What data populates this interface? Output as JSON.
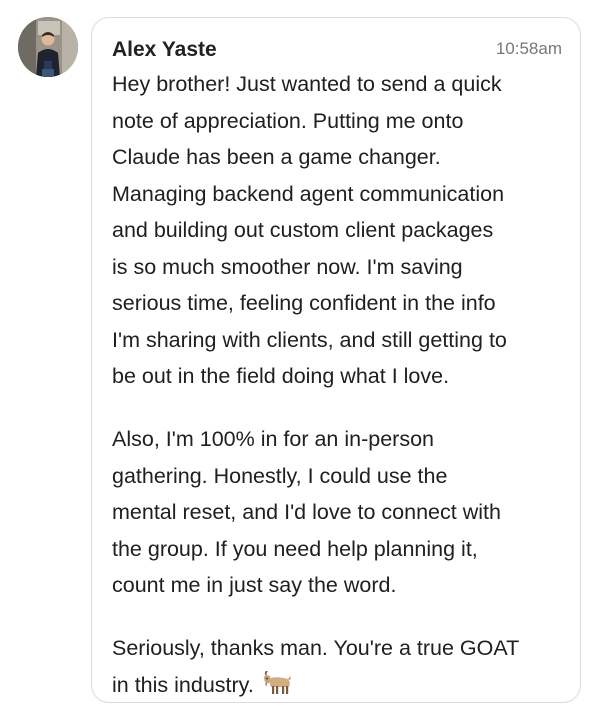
{
  "message": {
    "sender": "Alex Yaste",
    "time": "10:58am",
    "paragraph1": [
      "Hey brother! Just wanted to send a quick",
      "note of appreciation. Putting me onto",
      "Claude has been a game changer.",
      "Managing backend agent communication",
      "and building out custom client packages",
      "is so much smoother now. I'm saving",
      "serious time, feeling confident in the info",
      "I'm sharing with clients, and still getting to",
      "be out in the field doing what I love."
    ],
    "paragraph2": [
      "Also, I'm 100% in for an in-person",
      "gathering. Honestly, I could use the",
      "mental reset, and I'd love to connect with",
      "the group. If you need help planning it,",
      "count me in just say the word."
    ],
    "paragraph3": [
      "Seriously, thanks man. You're a true GOAT",
      "in this industry."
    ],
    "emoji": "goat-icon"
  },
  "colors": {
    "bubble_border": "#dcdcdc",
    "text": "#202020",
    "timestamp": "#777777"
  }
}
